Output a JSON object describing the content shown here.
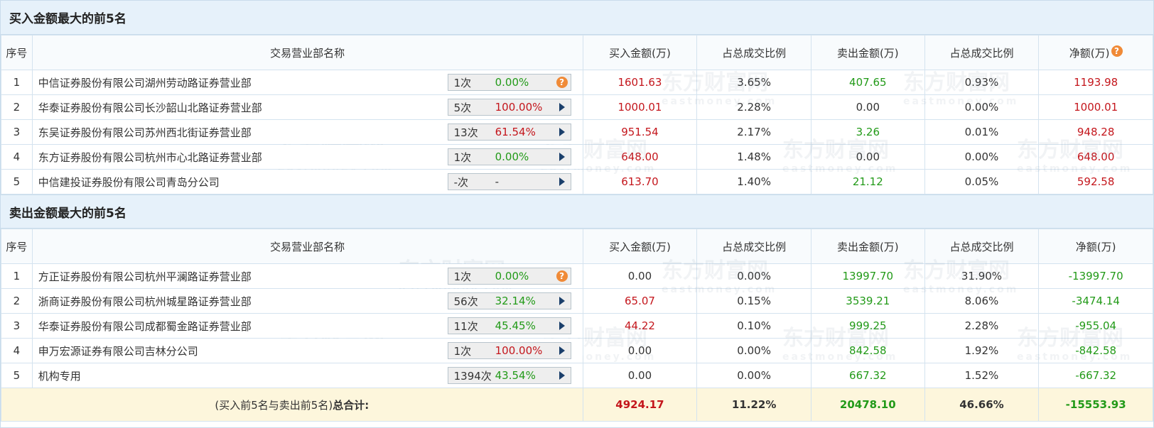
{
  "buy_section": {
    "title": "买入金额最大的前5名",
    "headers": [
      "序号",
      "交易营业部名称",
      "买入金额(万)",
      "占总成交比例",
      "卖出金额(万)",
      "占总成交比例",
      "净额(万)"
    ],
    "rows": [
      {
        "idx": "1",
        "name": "中信证券股份有限公司湖州劳动路证券营业部",
        "count": "1次",
        "pct": "0.00%",
        "pct_color": "green",
        "icon": "question-icon",
        "buy": "1601.63",
        "buy_ratio": "3.65%",
        "sell": "407.65",
        "sell_ratio": "0.93%",
        "net": "1193.98"
      },
      {
        "idx": "2",
        "name": "华泰证券股份有限公司长沙韶山北路证券营业部",
        "count": "5次",
        "pct": "100.00%",
        "pct_color": "red",
        "icon": "play-arrow-icon",
        "buy": "1000.01",
        "buy_ratio": "2.28%",
        "sell": "0.00",
        "sell_ratio": "0.00%",
        "net": "1000.01"
      },
      {
        "idx": "3",
        "name": "东吴证券股份有限公司苏州西北街证券营业部",
        "count": "13次",
        "pct": "61.54%",
        "pct_color": "red",
        "icon": "play-arrow-icon",
        "buy": "951.54",
        "buy_ratio": "2.17%",
        "sell": "3.26",
        "sell_ratio": "0.01%",
        "net": "948.28"
      },
      {
        "idx": "4",
        "name": "东方证券股份有限公司杭州市心北路证券营业部",
        "count": "1次",
        "pct": "0.00%",
        "pct_color": "green",
        "icon": "play-arrow-icon",
        "buy": "648.00",
        "buy_ratio": "1.48%",
        "sell": "0.00",
        "sell_ratio": "0.00%",
        "net": "648.00"
      },
      {
        "idx": "5",
        "name": "中信建投证券股份有限公司青岛分公司",
        "count": "-次",
        "pct": "-",
        "pct_color": "black",
        "icon": "play-arrow-icon",
        "buy": "613.70",
        "buy_ratio": "1.40%",
        "sell": "21.12",
        "sell_ratio": "0.05%",
        "net": "592.58"
      }
    ]
  },
  "sell_section": {
    "title": "卖出金额最大的前5名",
    "headers": [
      "序号",
      "交易营业部名称",
      "买入金额(万)",
      "占总成交比例",
      "卖出金额(万)",
      "占总成交比例",
      "净额(万)"
    ],
    "rows": [
      {
        "idx": "1",
        "name": "方正证券股份有限公司杭州平澜路证券营业部",
        "count": "1次",
        "pct": "0.00%",
        "pct_color": "green",
        "icon": "question-icon",
        "buy": "0.00",
        "buy_ratio": "0.00%",
        "sell": "13997.70",
        "sell_ratio": "31.90%",
        "net": "-13997.70"
      },
      {
        "idx": "2",
        "name": "浙商证券股份有限公司杭州城星路证券营业部",
        "count": "56次",
        "pct": "32.14%",
        "pct_color": "green",
        "icon": "play-arrow-icon",
        "buy": "65.07",
        "buy_ratio": "0.15%",
        "sell": "3539.21",
        "sell_ratio": "8.06%",
        "net": "-3474.14"
      },
      {
        "idx": "3",
        "name": "华泰证券股份有限公司成都蜀金路证券营业部",
        "count": "11次",
        "pct": "45.45%",
        "pct_color": "green",
        "icon": "play-arrow-icon",
        "buy": "44.22",
        "buy_ratio": "0.10%",
        "sell": "999.25",
        "sell_ratio": "2.28%",
        "net": "-955.04"
      },
      {
        "idx": "4",
        "name": "申万宏源证券有限公司吉林分公司",
        "count": "1次",
        "pct": "100.00%",
        "pct_color": "red",
        "icon": "play-arrow-icon",
        "buy": "0.00",
        "buy_ratio": "0.00%",
        "sell": "842.58",
        "sell_ratio": "1.92%",
        "net": "-842.58"
      },
      {
        "idx": "5",
        "name": "机构专用",
        "count": "1394次",
        "pct": "43.54%",
        "pct_color": "green",
        "icon": "play-arrow-icon",
        "buy": "0.00",
        "buy_ratio": "0.00%",
        "sell": "667.32",
        "sell_ratio": "1.52%",
        "net": "-667.32"
      }
    ]
  },
  "total": {
    "label_prefix": "(买入前5名与卖出前5名)",
    "label_bold": "总合计:",
    "buy": "4924.17",
    "buy_ratio": "11.22%",
    "sell": "20478.10",
    "sell_ratio": "46.66%",
    "net": "-15553.93"
  },
  "question_mark": "?",
  "watermark": {
    "cn": "东方财富网",
    "en": "eastmoney.com"
  },
  "colors": {
    "red": "#c4161c",
    "green": "#229a18",
    "header_bg": "#e6f1fa",
    "total_bg": "#fdf6dc",
    "help_icon": "#f08a37",
    "arrow": "#1b3f6b"
  }
}
